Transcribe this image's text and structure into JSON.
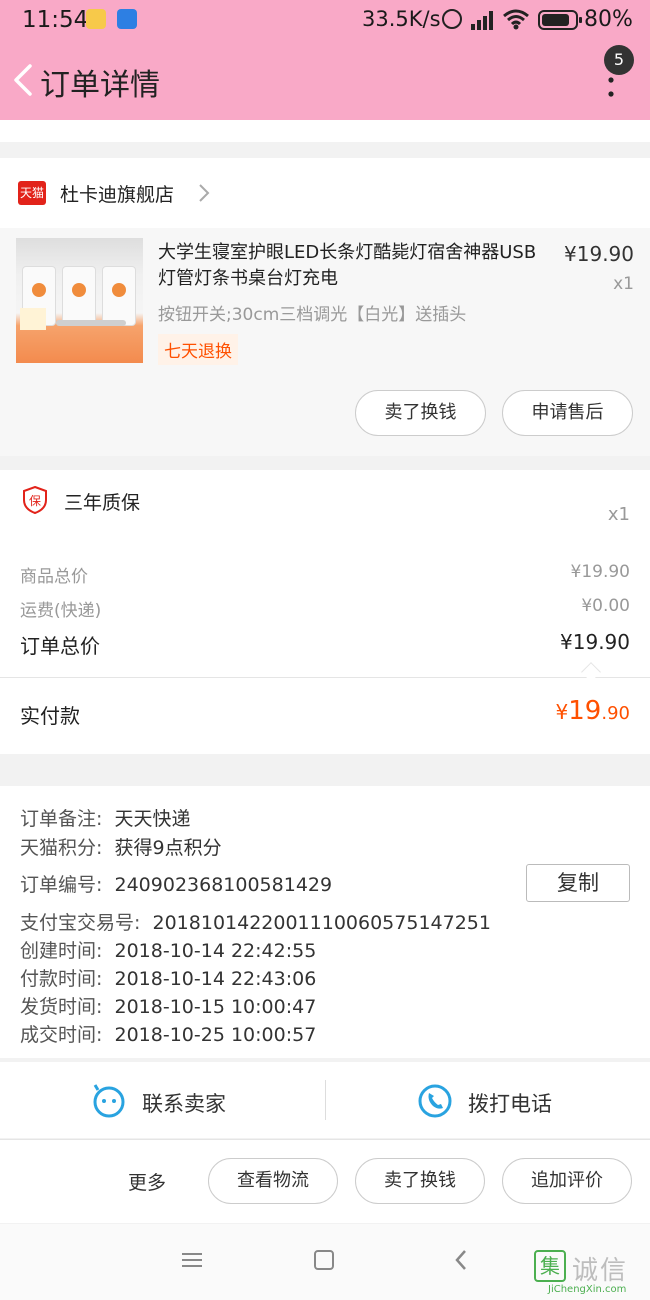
{
  "status_bar": {
    "time": "11:54",
    "network_speed": "33.5K/s",
    "battery": "80%"
  },
  "header": {
    "title": "订单详情",
    "badge_count": "5"
  },
  "shop": {
    "logo_text": "天猫",
    "name": "杜卡迪旗舰店"
  },
  "product": {
    "title": "大学生寝室护眼LED长条灯酷毙灯宿舍神器USB灯管灯条书桌台灯充电",
    "price": "¥19.90",
    "quantity": "x1",
    "spec": "按钮开关;30cm三档调光【白光】送插头",
    "tag": "七天退换",
    "btn_sell": "卖了换钱",
    "btn_after_sale": "申请售后"
  },
  "warranty": {
    "label": "三年质保",
    "quantity": "x1"
  },
  "summary": {
    "goods_label": "商品总价",
    "goods_value": "¥19.90",
    "shipping_label": "运费(快递)",
    "shipping_value": "¥0.00",
    "order_total_label": "订单总价",
    "order_total_value": "¥19.90",
    "paid_label": "实付款",
    "paid_currency": "¥",
    "paid_int": "19",
    "paid_dec": ".90"
  },
  "info": {
    "note_key": "订单备注:",
    "note_val": "天天快递",
    "points_key": "天猫积分:",
    "points_val": "获得9点积分",
    "order_no_key": "订单编号:",
    "order_no_val": "240902368100581429",
    "copy_label": "复制",
    "alipay_key": "支付宝交易号:",
    "alipay_val": "2018101422001110060575147251",
    "created_key": "创建时间:",
    "created_val": "2018-10-14 22:42:55",
    "paid_key": "付款时间:",
    "paid_val": "2018-10-14 22:43:06",
    "shipped_key": "发货时间:",
    "shipped_val": "2018-10-15 10:00:47",
    "done_key": "成交时间:",
    "done_val": "2018-10-25 10:00:57"
  },
  "contact": {
    "seller": "联系卖家",
    "phone": "拨打电话"
  },
  "actions": {
    "more": "更多",
    "logistics": "查看物流",
    "sell": "卖了换钱",
    "review": "追加评价"
  },
  "watermark": {
    "box_char": "集",
    "chars": "诚信",
    "url": "JiChengXin.com"
  }
}
